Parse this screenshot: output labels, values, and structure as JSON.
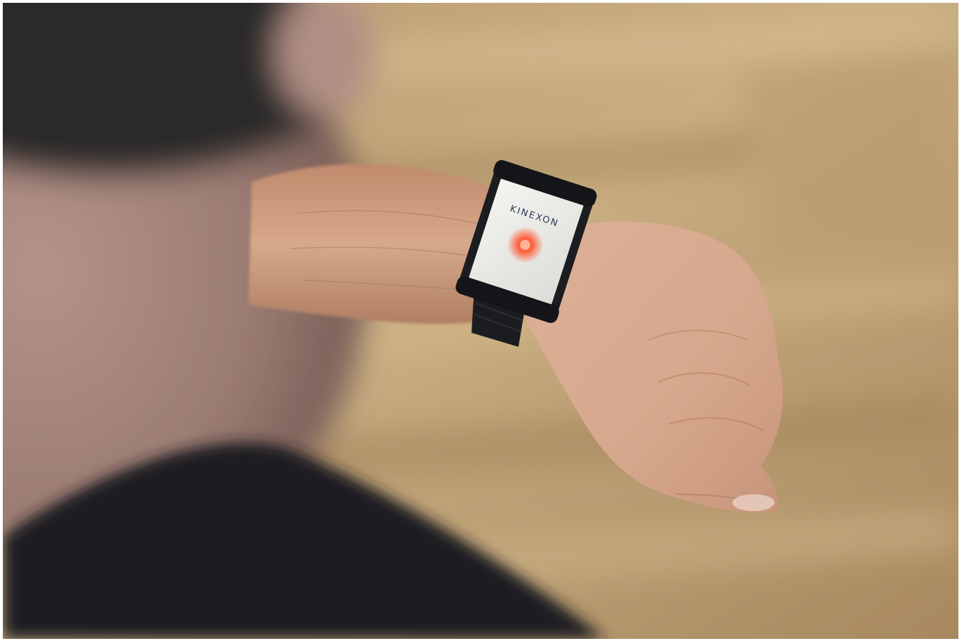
{
  "photo": {
    "device_brand": "KINEXON",
    "colors": {
      "floor_light": "#c8ac80",
      "floor_dark": "#9e8258",
      "skin": "#d3a488",
      "skin_shadow": "#b07f63",
      "band": "#1c1d20",
      "device_face": "#ecedea",
      "led": "#ff4a2a",
      "logo_text": "#2a3a52"
    }
  }
}
